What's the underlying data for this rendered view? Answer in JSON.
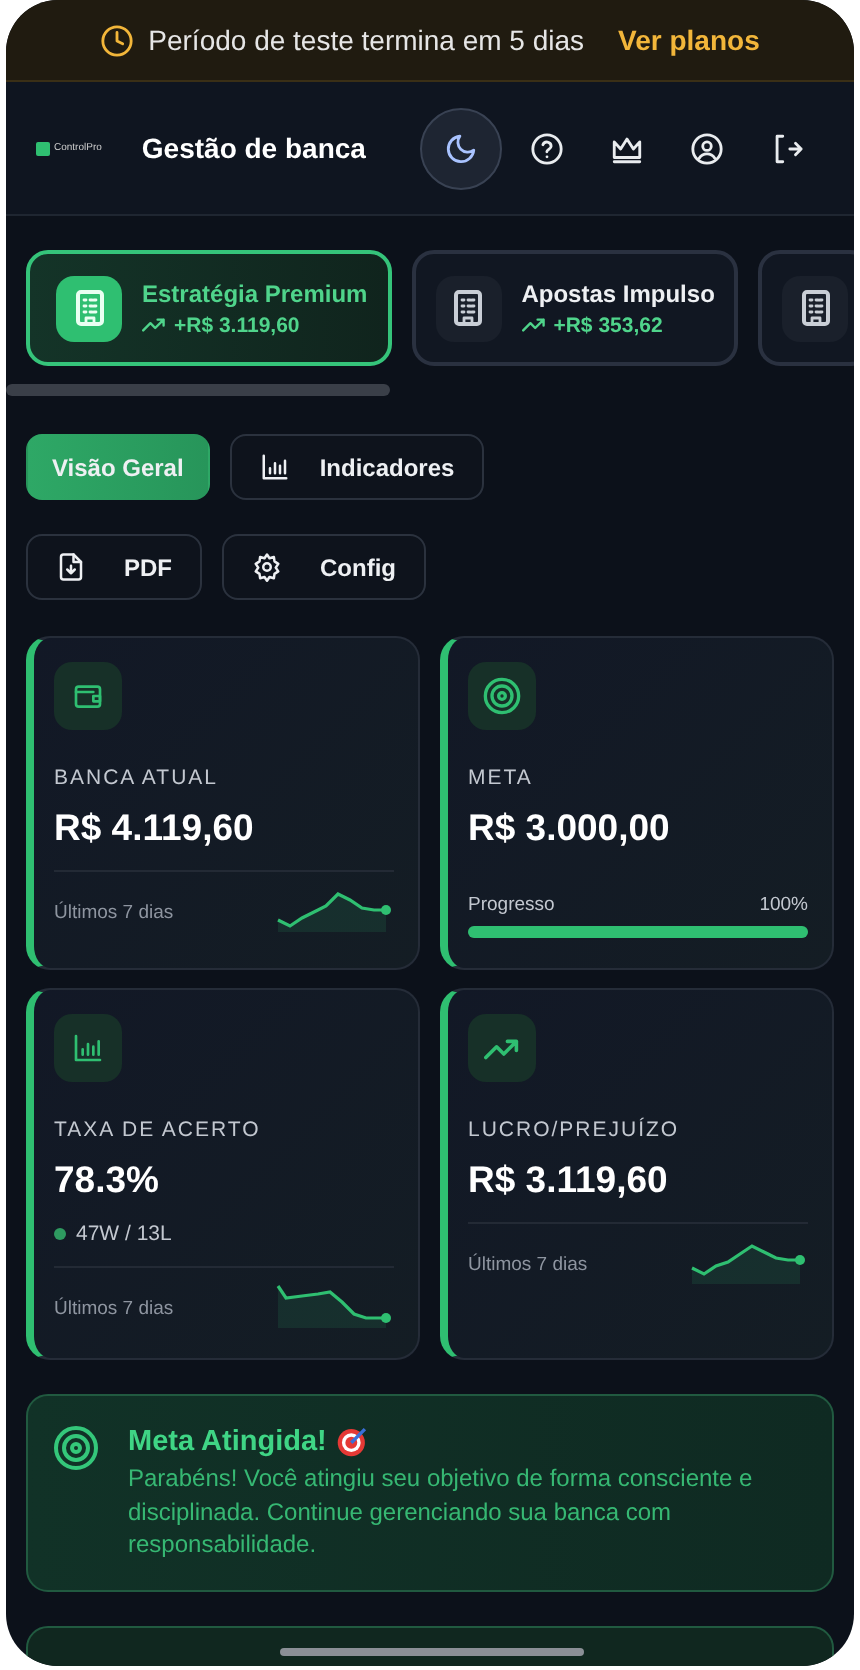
{
  "trial_banner": {
    "message": "Período de teste termina em 5 dias",
    "link": "Ver planos"
  },
  "header": {
    "logo": "ControlPro",
    "title": "Gestão de banca"
  },
  "strategies": [
    {
      "name": "Estratégia Premium",
      "profit": "+R$ 3.119,60",
      "selected": true
    },
    {
      "name": "Apostas Impulso",
      "profit": "+R$ 353,62",
      "selected": false
    },
    {
      "selected": false
    }
  ],
  "tabs": [
    {
      "label": "Visão Geral",
      "selected": true
    },
    {
      "label": "Indicadores",
      "selected": false
    }
  ],
  "actions": [
    "PDF",
    "Config"
  ],
  "cards": [
    {
      "kind": "trend",
      "label": "BANCA ATUAL",
      "value": "R$ 4.119,60",
      "footer": "Últimos 7 dias"
    },
    {
      "kind": "progress",
      "label": "META",
      "value": "R$ 3.000,00",
      "progress_label": "Progresso",
      "progress_text": "100%",
      "level": 1.0
    },
    {
      "kind": "trend",
      "label": "TAXA DE ACERTO",
      "value": "78.3%",
      "record": "47W / 13L",
      "footer": "Últimos 7 dias"
    },
    {
      "kind": "trend",
      "label": "LUCRO/PREJUÍZO",
      "value": "R$ 3.119,60",
      "footer": "Últimos 7 dias"
    }
  ],
  "goal_alert": {
    "title": "Meta Atingida!",
    "message": "Parabéns! Você atingiu seu objetivo de forma consciente e disciplinada. Continue gerenciando sua banca com responsabilidade."
  }
}
